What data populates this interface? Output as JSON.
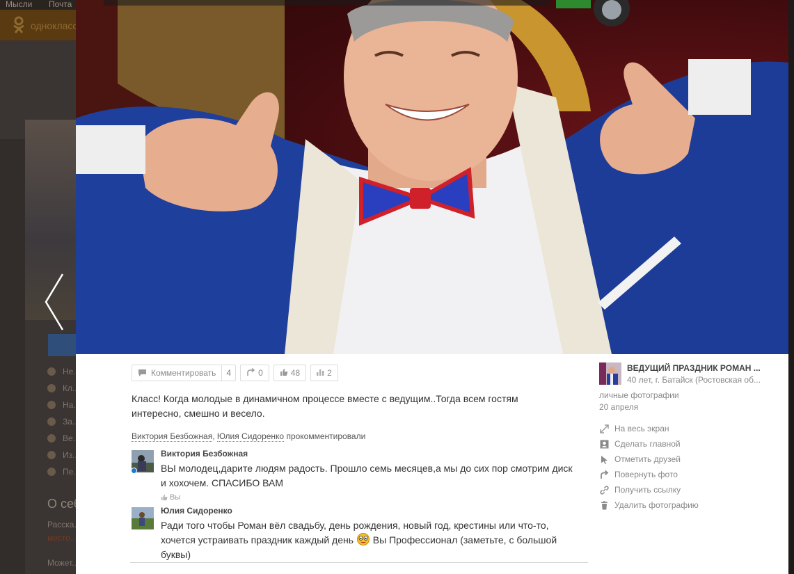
{
  "background": {
    "top_links": [
      "Мысли",
      "Почта"
    ],
    "site_name": "одноклассники",
    "menu_items": [
      "Не...",
      "Кл...",
      "На...",
      "За...",
      "Ве...",
      "Из...",
      "Пе..."
    ],
    "about_title": "О себ...",
    "about_line1": "Расска...",
    "about_line2": "место...",
    "about_line3": "Может..."
  },
  "photo": {
    "description_icon": "photo"
  },
  "actions": {
    "comment_label": "Комментировать",
    "comment_count": "4",
    "reshare_count": "0",
    "like_count": "48",
    "stats_count": "2"
  },
  "caption": "Класс! Когда молодые в динамичном процессе вместе с ведущим..Тогда всем гостям интересно, смешно и весело.",
  "commenters": {
    "name1": "Виктория Безбожная",
    "separator": ", ",
    "name2": "Юлия Сидоренко",
    "suffix": " прокомментировали"
  },
  "comments": [
    {
      "author": "Виктория Безбожная",
      "text": "ВЫ молодец,дарите людям радость. Прошло семь месяцев,а мы до сих пор смотрим диск и хохочем. СПАСИБО ВАМ",
      "like_label": "Вы"
    },
    {
      "author": "Юлия Сидоренко",
      "text_part1": "Ради того чтобы Роман вёл свадьбу,  день рождения,  новый год,  крестины или что-то,  хочется устраивать праздник каждый день ",
      "text_part2": " Вы Профессионал (заметьте,  с большой буквы)"
    }
  ],
  "owner": {
    "name": "ВЕДУЩИЙ ПРАЗДНИК РОМАН ...",
    "info": "40 лет, г. Батайск (Ростовская об...",
    "album": "личные фотографии",
    "date": "20 апреля"
  },
  "side_menu": [
    {
      "label": "На весь экран",
      "icon": "fullscreen-icon"
    },
    {
      "label": "Сделать главной",
      "icon": "profile-card-icon"
    },
    {
      "label": "Отметить друзей",
      "icon": "cursor-icon"
    },
    {
      "label": "Повернуть фото",
      "icon": "rotate-icon"
    },
    {
      "label": "Получить ссылку",
      "icon": "link-icon"
    },
    {
      "label": "Удалить фотографию",
      "icon": "trash-icon"
    }
  ]
}
